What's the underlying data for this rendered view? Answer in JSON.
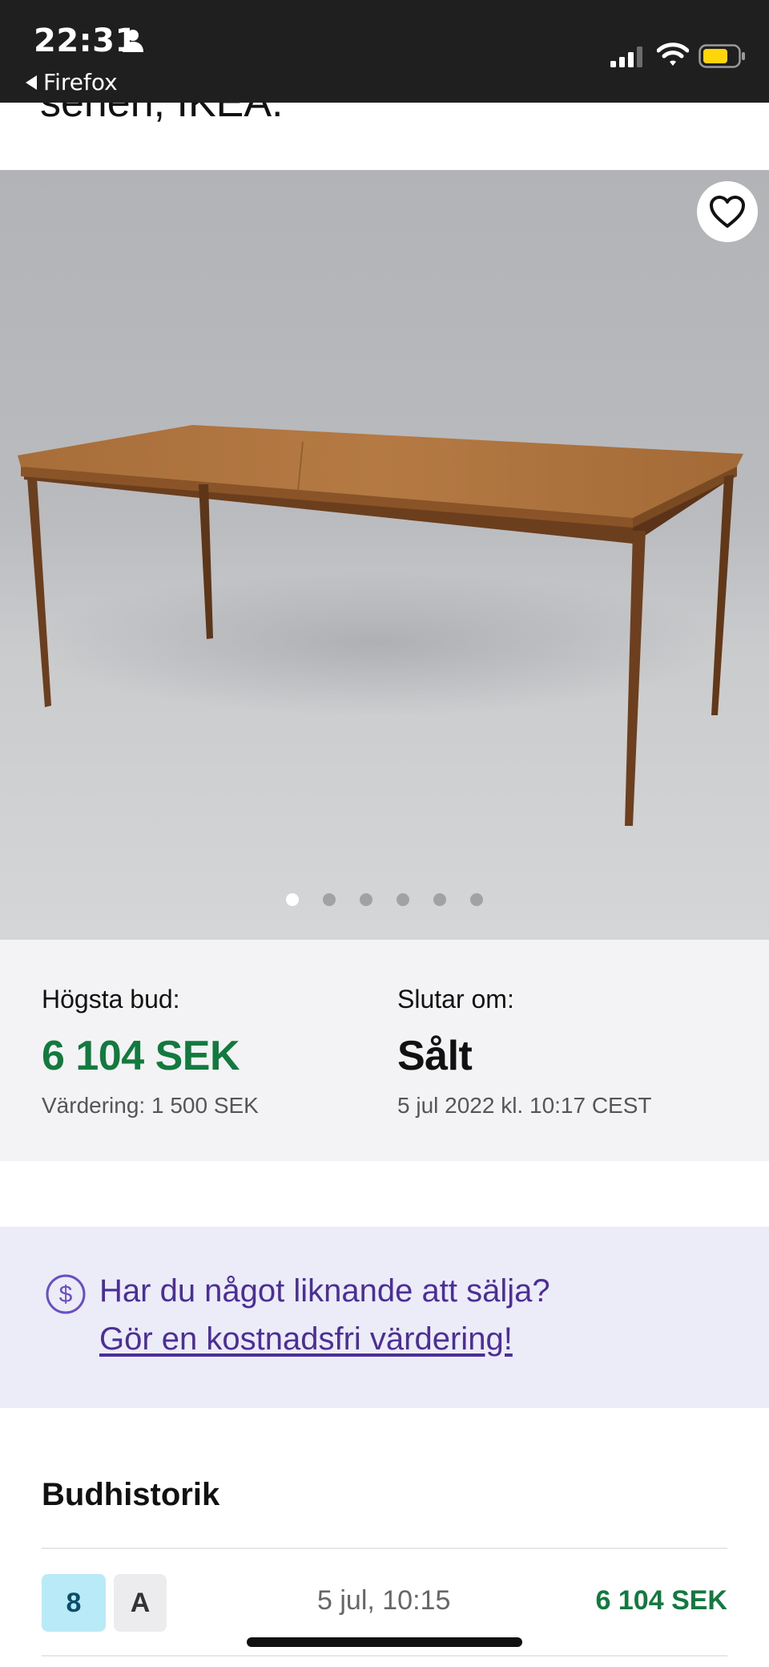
{
  "status_bar": {
    "time": "22:31",
    "back_app": "Firefox",
    "icons": [
      "person-icon",
      "signal-icon",
      "wifi-icon",
      "battery-icon"
    ],
    "battery_color": "#ffd60a"
  },
  "listing": {
    "title_fragment": "serien, IKEA."
  },
  "gallery": {
    "image_count": 6,
    "active_index": 0,
    "favorite_icon": "heart-outline-icon"
  },
  "price": {
    "highest_bid_label": "Högsta bud:",
    "highest_bid_value": "6 104 SEK",
    "valuation": "Värdering: 1 500 SEK",
    "ends_label": "Slutar om:",
    "ends_value": "Sålt",
    "ended_at": "5 jul 2022 kl. 10:17 CEST"
  },
  "sell_banner": {
    "icon": "dollar-circle-icon",
    "question": "Har du något liknande att sälja?",
    "link": "Gör en kostnadsfri värdering!"
  },
  "bid_history": {
    "heading": "Budhistorik",
    "rows": [
      {
        "count": "8",
        "bidder": "A",
        "time": "5 jul, 10:15",
        "amount": "6 104 SEK"
      }
    ]
  },
  "colors": {
    "accent_green": "#127a3f",
    "banner_purple": "#4b2e96",
    "banner_bg": "#ecebf8",
    "status_bar_bg": "#1f1f1f"
  }
}
